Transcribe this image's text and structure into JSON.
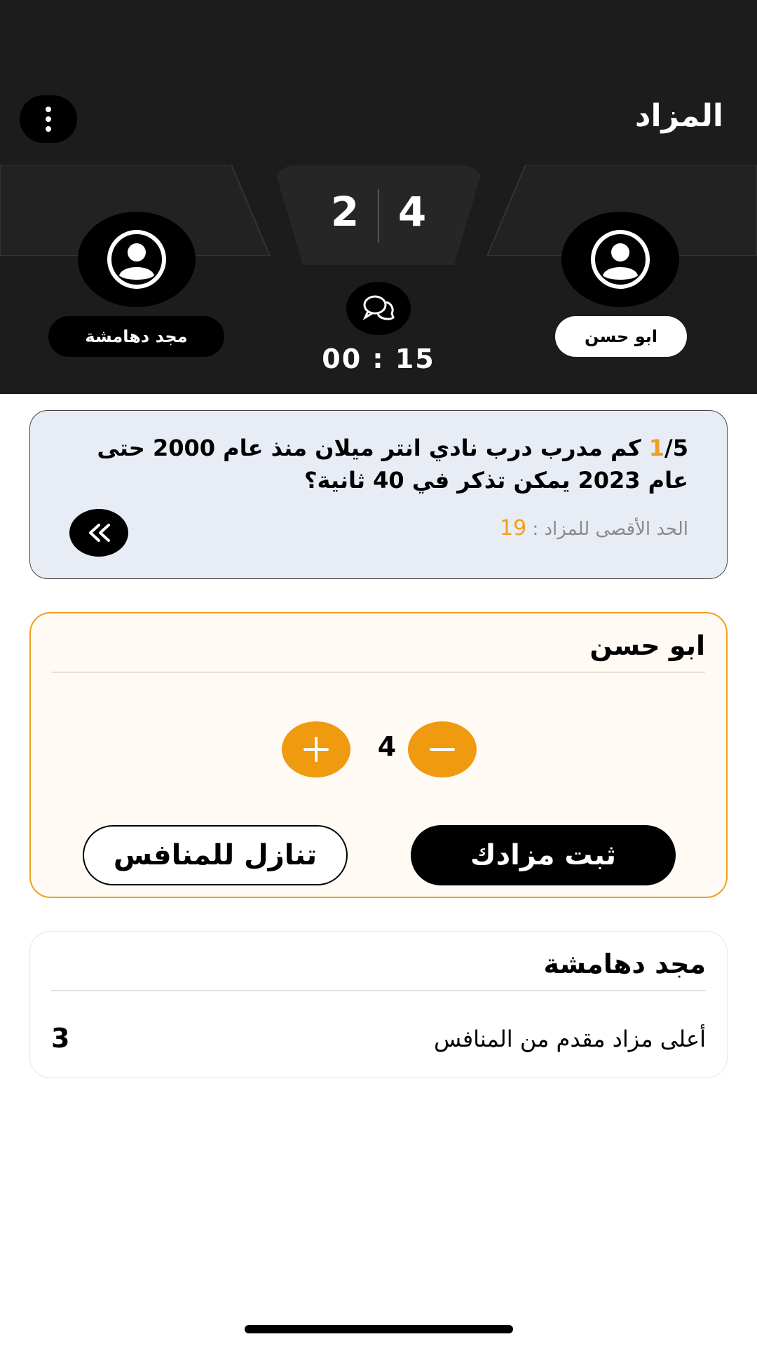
{
  "app": {
    "title": "المزاد",
    "menu_icon": "more-vertical-icon"
  },
  "scoreboard": {
    "right_score": "4",
    "left_score": "2",
    "timer": "00 : 15",
    "chat_icon": "chat-bubbles-icon"
  },
  "players": {
    "right": {
      "name": "ابو حسن",
      "avatar_icon": "user-icon"
    },
    "left": {
      "name": "مجد دهامشة",
      "avatar_icon": "user-icon"
    }
  },
  "question": {
    "number": "1",
    "total_suffix": "/5",
    "text": " كم مدرب درب نادي انتر ميلان منذ عام 2000 حتى عام 2023 يمكن تذكر في 40 ثانية؟",
    "max_label": "الحد الأقصى للمزاد : ",
    "max_value": "19",
    "next_icon": "double-chevron-left-icon"
  },
  "bid_card": {
    "player_name": "ابو حسن",
    "bid_value": "4",
    "plus_icon": "plus-icon",
    "minus_icon": "minus-icon",
    "confirm_label": "ثبت مزادك",
    "forfeit_label": "تنازل للمنافس"
  },
  "opponent_card": {
    "player_name": "مجد دهامشة",
    "highest_label": "أعلى مزاد مقدم من المنافس",
    "highest_value": "3"
  },
  "colors": {
    "header_bg": "#1c1c1c",
    "accent": "#f09a10",
    "question_bg": "#e8ecf4",
    "bid_card_bg": "#fffaf3"
  }
}
